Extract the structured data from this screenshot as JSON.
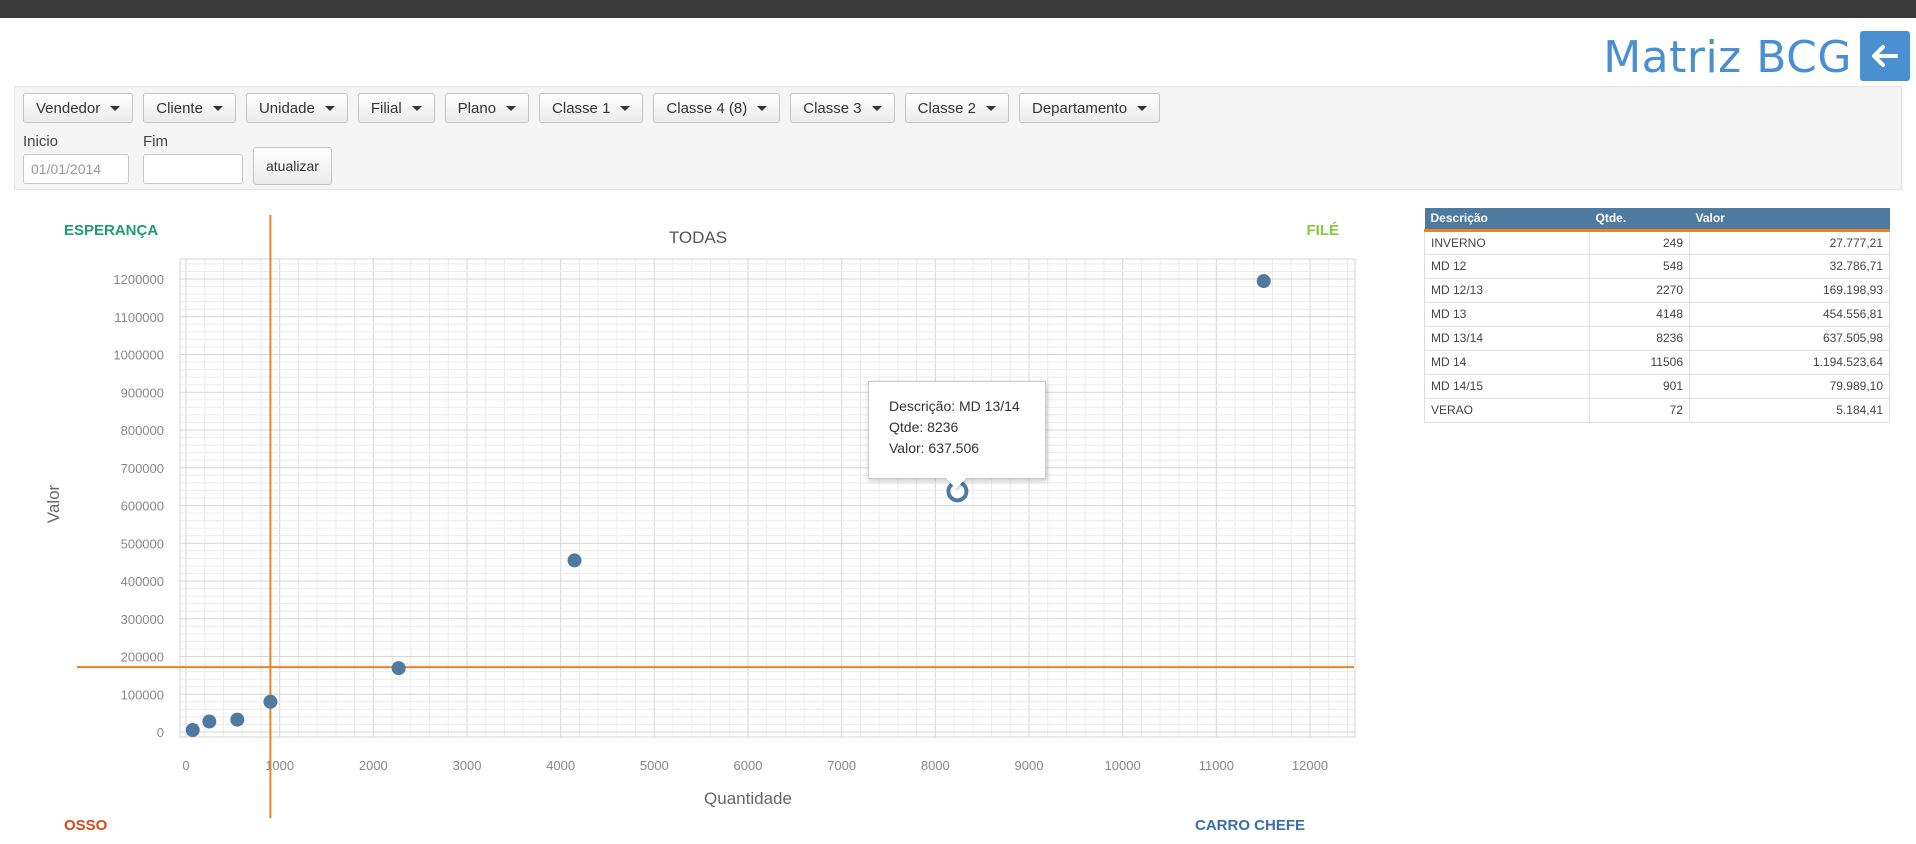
{
  "header": {
    "title": "Matriz BCG",
    "back_button": "arrow-left-icon"
  },
  "filters": {
    "dropdowns": [
      "Vendedor",
      "Cliente",
      "Unidade",
      "Filial",
      "Plano",
      "Classe 1",
      "Classe 4 (8)",
      "Classe 3",
      "Classe 2",
      "Departamento"
    ],
    "inicio_label": "Inicio",
    "inicio_placeholder": "01/01/2014",
    "fim_label": "Fim",
    "fim_value": "",
    "update_label": "atualizar"
  },
  "quadrants": {
    "top_left": "ESPERANÇA",
    "top_right": "FILÉ",
    "bottom_left": "OSSO",
    "bottom_right": "CARRO CHEFE"
  },
  "colors": {
    "accent": "#4a8fd0",
    "point": "#4f7aa0",
    "divider": "#e8832e",
    "esperanca": "#1f9b74",
    "file": "#8cc63f",
    "osso": "#d04a1c",
    "carro_chefe": "#3b6fa6",
    "table_header": "#4f7aa0"
  },
  "chart_data": {
    "type": "scatter",
    "title": "TODAS",
    "xlabel": "Quantidade",
    "ylabel": "Valor",
    "xlim": [
      -400,
      12500
    ],
    "ylim": [
      0,
      1200000
    ],
    "xticks": [
      0,
      1000,
      2000,
      3000,
      4000,
      5000,
      6000,
      7000,
      8000,
      9000,
      10000,
      11000,
      12000
    ],
    "yticks": [
      0,
      100000,
      200000,
      300000,
      400000,
      500000,
      600000,
      700000,
      800000,
      900000,
      1000000,
      1100000,
      1200000
    ],
    "grid": true,
    "divider_x": 901,
    "divider_y": 172000,
    "points": [
      {
        "label": "INVERNO",
        "x": 249,
        "y": 27777
      },
      {
        "label": "MD 12",
        "x": 548,
        "y": 32787
      },
      {
        "label": "MD 12/13",
        "x": 2270,
        "y": 169199
      },
      {
        "label": "MD 13",
        "x": 4148,
        "y": 454557
      },
      {
        "label": "MD 13/14",
        "x": 8236,
        "y": 637506
      },
      {
        "label": "MD 14",
        "x": 11506,
        "y": 1194524
      },
      {
        "label": "MD 14/15",
        "x": 901,
        "y": 79989
      },
      {
        "label": "VERAO",
        "x": 72,
        "y": 5184
      }
    ],
    "highlighted": "MD 13/14"
  },
  "tooltip": {
    "descricao": "Descrição: MD 13/14",
    "qtde": "Qtde: 8236",
    "valor": "Valor: 637.506"
  },
  "table": {
    "headers": [
      "Descrição",
      "Qtde.",
      "Valor"
    ],
    "rows": [
      [
        "INVERNO",
        "249",
        "27.777,21"
      ],
      [
        "MD 12",
        "548",
        "32.786,71"
      ],
      [
        "MD 12/13",
        "2270",
        "169.198,93"
      ],
      [
        "MD 13",
        "4148",
        "454.556,81"
      ],
      [
        "MD 13/14",
        "8236",
        "637.505,98"
      ],
      [
        "MD 14",
        "11506",
        "1.194.523,64"
      ],
      [
        "MD 14/15",
        "901",
        "79.989,10"
      ],
      [
        "VERAO",
        "72",
        "5.184,41"
      ]
    ]
  }
}
